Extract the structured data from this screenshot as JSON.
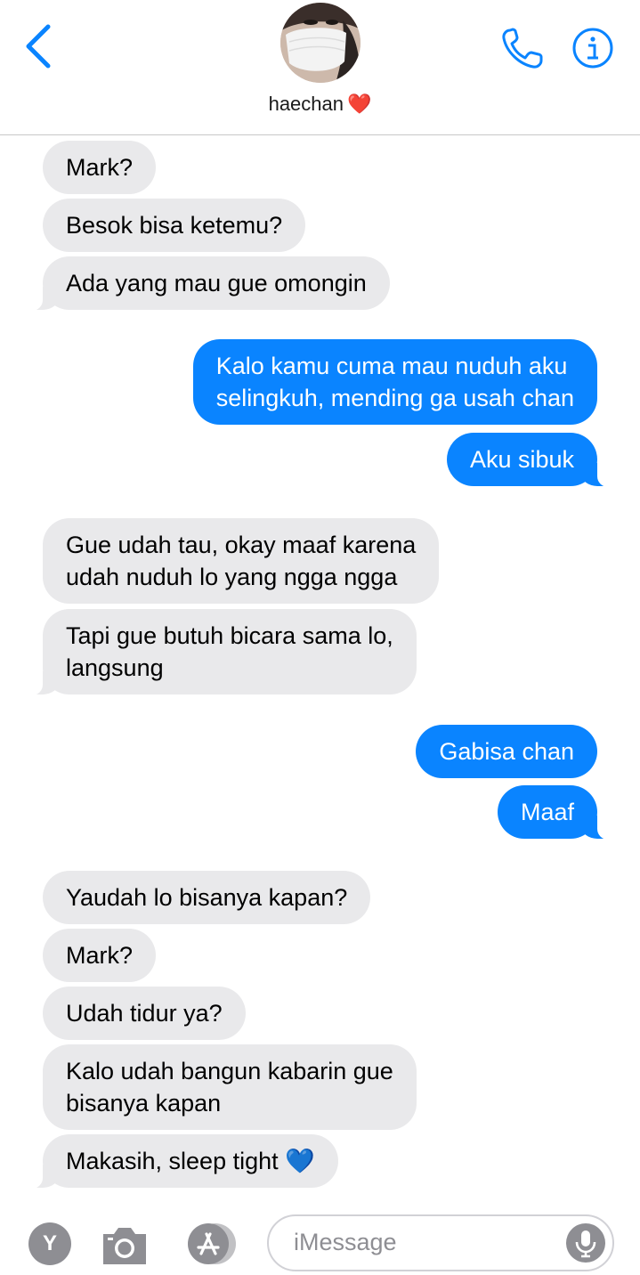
{
  "header": {
    "contact_name": "haechan",
    "contact_emoji": "❤️"
  },
  "messages": [
    {
      "dir": "in",
      "text": "Mark?"
    },
    {
      "dir": "in",
      "text": "Besok bisa ketemu?"
    },
    {
      "dir": "in",
      "text": "Ada yang mau gue omongin"
    },
    {
      "dir": "out",
      "text": "Kalo kamu cuma mau nuduh aku\nselingkuh, mending ga usah chan"
    },
    {
      "dir": "out",
      "text": "Aku sibuk"
    },
    {
      "dir": "in",
      "text": "Gue udah tau, okay maaf karena\nudah nuduh lo yang ngga ngga"
    },
    {
      "dir": "in",
      "text": "Tapi gue butuh bicara sama lo,\nlangsung"
    },
    {
      "dir": "out",
      "text": "Gabisa chan"
    },
    {
      "dir": "out",
      "text": "Maaf"
    },
    {
      "dir": "in",
      "text": "Yaudah lo bisanya kapan?"
    },
    {
      "dir": "in",
      "text": "Mark?"
    },
    {
      "dir": "in",
      "text": "Udah tidur ya?"
    },
    {
      "dir": "in",
      "text": "Kalo udah bangun kabarin gue\nbisanya kapan"
    },
    {
      "dir": "in",
      "text": "Makasih, sleep tight",
      "emoji": "💙"
    }
  ],
  "composer": {
    "placeholder": "iMessage",
    "app_icon_letter": "Y"
  },
  "colors": {
    "accent": "#0a84ff",
    "incoming_bubble": "#e9e9eb"
  }
}
